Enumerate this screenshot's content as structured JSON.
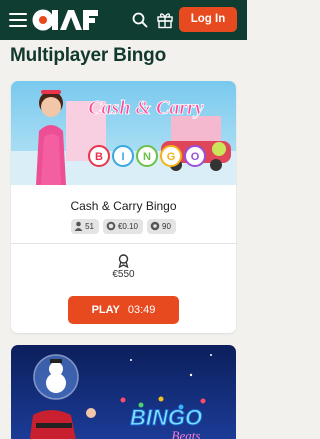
{
  "header": {
    "logo_text": "PAF",
    "login_label": "Log In",
    "icons": [
      "menu-icon",
      "search-icon",
      "gift-icon"
    ]
  },
  "page": {
    "title": "Multiplayer Bingo"
  },
  "games": [
    {
      "title": "Cash & Carry Bingo",
      "banner_logo_top": "Cash & Carry",
      "banner_logo_bottom": "BINGO",
      "players": "51",
      "ticket_price": "€0.10",
      "balls": "90",
      "jackpot": "€550",
      "play_label": "PLAY",
      "countdown": "03:49"
    },
    {
      "banner_logo_top": "BINGO",
      "banner_logo_bottom": "Beats"
    }
  ],
  "colors": {
    "header_bg": "#103d32",
    "accent": "#e84a1f",
    "page_bg": "#f2f1ee",
    "title": "#12392e"
  }
}
